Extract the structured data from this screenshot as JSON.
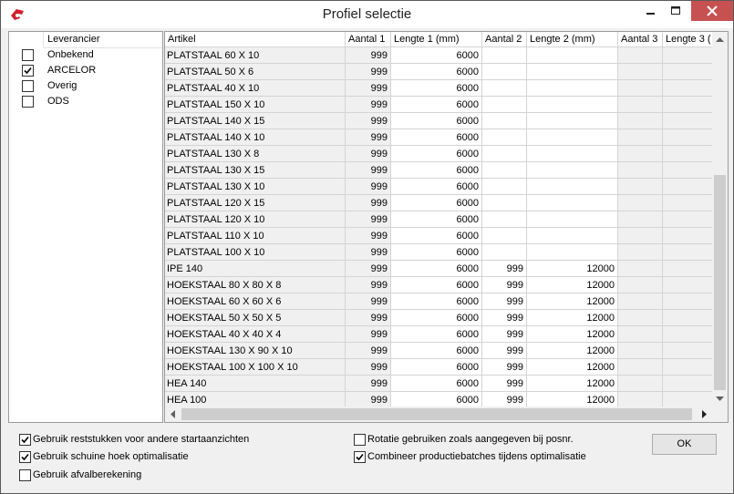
{
  "window": {
    "title": "Profiel selectie",
    "accent": "#c75050"
  },
  "suppliers": {
    "header": "Leverancier",
    "items": [
      {
        "label": "Onbekend",
        "checked": false
      },
      {
        "label": "ARCELOR",
        "checked": true
      },
      {
        "label": "Overig",
        "checked": false
      },
      {
        "label": "ODS",
        "checked": false
      }
    ]
  },
  "grid": {
    "columns": [
      "Artikel",
      "Aantal 1",
      "Lengte 1 (mm)",
      "Aantal 2",
      "Lengte 2 (mm)",
      "Aantal 3",
      "Lengte 3 ("
    ],
    "rows": [
      [
        "PLATSTAAL 60 X 10",
        "999",
        "6000",
        "",
        ""
      ],
      [
        "PLATSTAAL 50 X 6",
        "999",
        "6000",
        "",
        ""
      ],
      [
        "PLATSTAAL 40 X 10",
        "999",
        "6000",
        "",
        ""
      ],
      [
        "PLATSTAAL 150 X 10",
        "999",
        "6000",
        "",
        ""
      ],
      [
        "PLATSTAAL 140 X 15",
        "999",
        "6000",
        "",
        ""
      ],
      [
        "PLATSTAAL 140 X 10",
        "999",
        "6000",
        "",
        ""
      ],
      [
        "PLATSTAAL 130 X 8",
        "999",
        "6000",
        "",
        ""
      ],
      [
        "PLATSTAAL 130 X 15",
        "999",
        "6000",
        "",
        ""
      ],
      [
        "PLATSTAAL 130 X 10",
        "999",
        "6000",
        "",
        ""
      ],
      [
        "PLATSTAAL 120 X 15",
        "999",
        "6000",
        "",
        ""
      ],
      [
        "PLATSTAAL 120 X 10",
        "999",
        "6000",
        "",
        ""
      ],
      [
        "PLATSTAAL 110 X 10",
        "999",
        "6000",
        "",
        ""
      ],
      [
        "PLATSTAAL 100 X 10",
        "999",
        "6000",
        "",
        ""
      ],
      [
        "IPE 140",
        "999",
        "6000",
        "999",
        "12000"
      ],
      [
        "HOEKSTAAL 80 X  80 X  8",
        "999",
        "6000",
        "999",
        "12000"
      ],
      [
        "HOEKSTAAL 60 X 60 X  6",
        "999",
        "6000",
        "999",
        "12000"
      ],
      [
        "HOEKSTAAL 50 X 50 X  5",
        "999",
        "6000",
        "999",
        "12000"
      ],
      [
        "HOEKSTAAL 40 X 40 X 4",
        "999",
        "6000",
        "999",
        "12000"
      ],
      [
        "HOEKSTAAL 130 X  90 X 10",
        "999",
        "6000",
        "999",
        "12000"
      ],
      [
        "HOEKSTAAL 100 X 100 X 10",
        "999",
        "6000",
        "999",
        "12000"
      ],
      [
        "HEA  140",
        "999",
        "6000",
        "999",
        "12000"
      ],
      [
        "HEA  100",
        "999",
        "6000",
        "999",
        "12000"
      ]
    ]
  },
  "options": {
    "reststukken": {
      "label": "Gebruik reststukken voor andere startaanzichten",
      "checked": true
    },
    "schuine_hoek": {
      "label": "Gebruik schuine hoek optimalisatie",
      "checked": true
    },
    "afvalberekening": {
      "label": "Gebruik afvalberekening",
      "checked": false
    },
    "rotatie": {
      "label": "Rotatie gebruiken zoals aangegeven bij posnr.",
      "checked": false
    },
    "combineer": {
      "label": "Combineer productiebatches tijdens optimalisatie",
      "checked": true
    }
  },
  "ok_label": "OK"
}
